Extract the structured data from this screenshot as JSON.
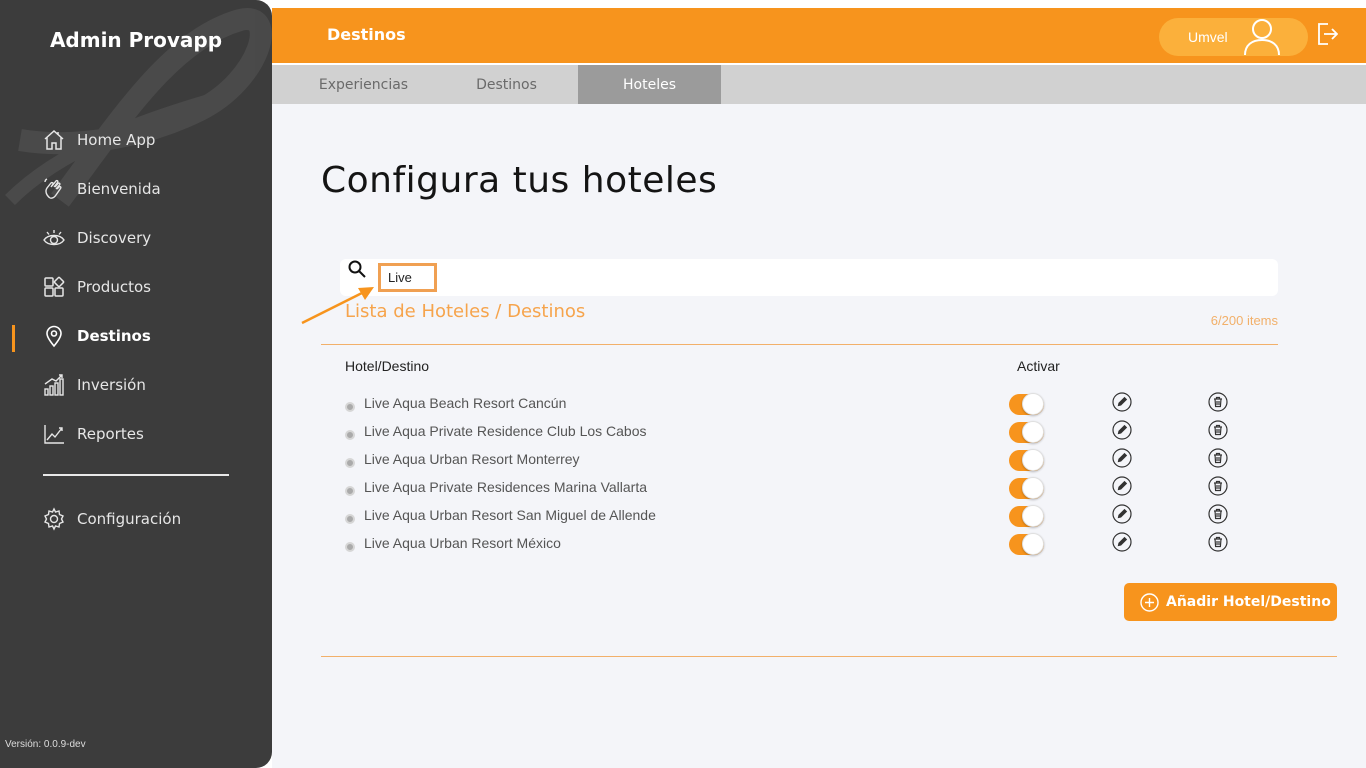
{
  "sidebar": {
    "brand": "Admin Provapp",
    "items": [
      {
        "label": "Home App",
        "icon": "home-icon"
      },
      {
        "label": "Bienvenida",
        "icon": "waving-hand-icon"
      },
      {
        "label": "Discovery",
        "icon": "eye-icon"
      },
      {
        "label": "Productos",
        "icon": "grid-icon"
      },
      {
        "label": "Destinos",
        "icon": "location-pin-icon"
      },
      {
        "label": "Inversión",
        "icon": "bar-chart-icon"
      },
      {
        "label": "Reportes",
        "icon": "line-chart-icon"
      }
    ],
    "config": {
      "label": "Configuración",
      "icon": "gear-icon"
    },
    "active": "Destinos",
    "version": "Versión: 0.0.9-dev"
  },
  "header": {
    "title": "Destinos",
    "user": "Umvel"
  },
  "tabs": [
    {
      "label": "Experiencias"
    },
    {
      "label": "Destinos"
    },
    {
      "label": "Hoteles"
    }
  ],
  "active_tab": "Hoteles",
  "main": {
    "title": "Configura tus hoteles",
    "search": {
      "value": "Live"
    },
    "list_title": "Lista de Hoteles / Destinos",
    "count": "6/200 items",
    "columns": {
      "name": "Hotel/Destino",
      "activate": "Activar"
    },
    "rows": [
      {
        "name": "Live Aqua Beach Resort Cancún",
        "active": true
      },
      {
        "name": "Live Aqua Private Residence Club Los Cabos",
        "active": true
      },
      {
        "name": "Live Aqua Urban Resort Monterrey",
        "active": true
      },
      {
        "name": "Live Aqua Private Residences Marina Vallarta",
        "active": true
      },
      {
        "name": "Live Aqua Urban Resort San Miguel de Allende",
        "active": true
      },
      {
        "name": "Live Aqua Urban Resort México",
        "active": true
      }
    ],
    "add_button": "Añadir Hotel/Destino"
  },
  "colors": {
    "accent": "#f7941d",
    "sidebar": "#3c3c3c"
  }
}
